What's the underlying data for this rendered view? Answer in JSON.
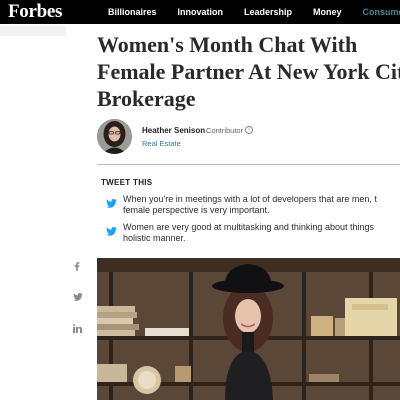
{
  "brand": {
    "logo": "Forbes"
  },
  "nav": {
    "items": [
      {
        "label": "Billionaires",
        "active": false
      },
      {
        "label": "Innovation",
        "active": false
      },
      {
        "label": "Leadership",
        "active": false
      },
      {
        "label": "Money",
        "active": false
      },
      {
        "label": "Consumer",
        "active": true
      }
    ]
  },
  "article": {
    "headline_lines": [
      "Women's Month Chat With",
      "Female Partner At New York City",
      "Brokerage"
    ],
    "author": {
      "name": "Heather Senison",
      "role": "Contributor",
      "info_icon": "info-icon",
      "section": "Real Estate"
    }
  },
  "tweet_this": {
    "title": "TWEET THIS",
    "items": [
      {
        "line1": "When you're in meetings with a lot of developers that are men, t",
        "line2": "female perspective is very important."
      },
      {
        "line1": "Women are very good at multitasking and thinking about things",
        "line2": "holistic manner."
      }
    ]
  },
  "share": {
    "icons": [
      "facebook-icon",
      "twitter-icon",
      "linkedin-icon"
    ]
  },
  "colors": {
    "accent": "#3b8aa0",
    "twitter": "#1da1f2",
    "link": "#2f7d98"
  }
}
